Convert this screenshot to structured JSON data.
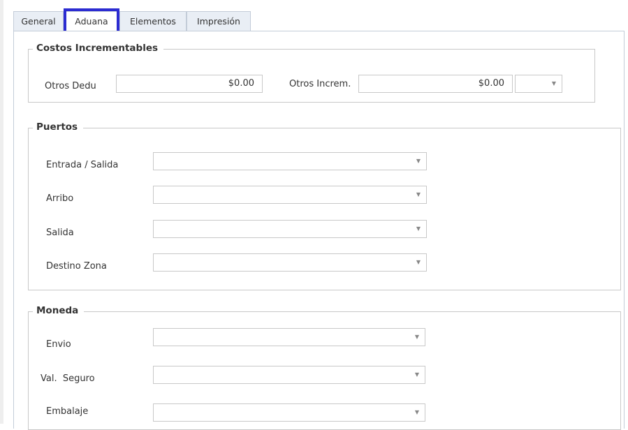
{
  "tabs": [
    {
      "label": "General",
      "active": false
    },
    {
      "label": "Aduana",
      "active": true
    },
    {
      "label": "Elementos",
      "active": false
    },
    {
      "label": "Impresión",
      "active": false
    }
  ],
  "costos": {
    "title": "Costos Incrementables",
    "otros_dedu_label": "Otros Dedu",
    "otros_dedu_value": "$0.00",
    "otros_increm_label": "Otros Increm.",
    "otros_increm_value": "$0.00",
    "currency_value": ""
  },
  "puertos": {
    "title": "Puertos",
    "fields": [
      {
        "label": "Entrada / Salida",
        "value": ""
      },
      {
        "label": "Arribo",
        "value": ""
      },
      {
        "label": "Salida",
        "value": ""
      },
      {
        "label": "Destino Zona",
        "value": ""
      }
    ]
  },
  "moneda": {
    "title": "Moneda",
    "fields": [
      {
        "label": "Envio",
        "value": ""
      },
      {
        "label": "Val.  Seguro",
        "value": ""
      },
      {
        "label": "Embalaje",
        "value": ""
      }
    ]
  },
  "icons": {
    "dropdown": "▼"
  },
  "colors": {
    "tab_highlight": "#2c2cd1",
    "tab_bg": "#e9eef5",
    "border": "#c8c8c8"
  }
}
